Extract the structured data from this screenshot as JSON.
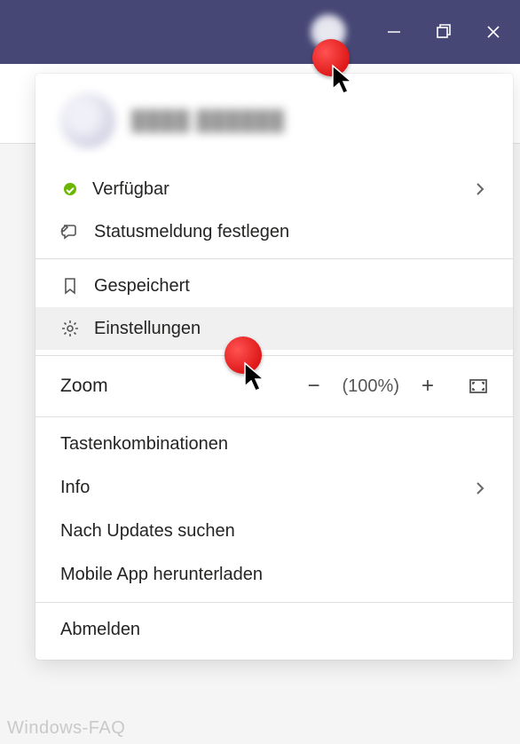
{
  "titlebar": {
    "avatar": "user-avatar"
  },
  "profile": {
    "name": "████ ██████"
  },
  "status": {
    "label": "Verfügbar",
    "color": "#6bb700",
    "set_message": "Statusmeldung festlegen"
  },
  "menu": {
    "saved": "Gespeichert",
    "settings": "Einstellungen"
  },
  "zoom": {
    "label": "Zoom",
    "value": "(100%)"
  },
  "extra": {
    "shortcuts": "Tastenkombinationen",
    "info": "Info",
    "updates": "Nach Updates suchen",
    "mobile": "Mobile App herunterladen",
    "signout": "Abmelden"
  },
  "watermark": "Windows-FAQ"
}
